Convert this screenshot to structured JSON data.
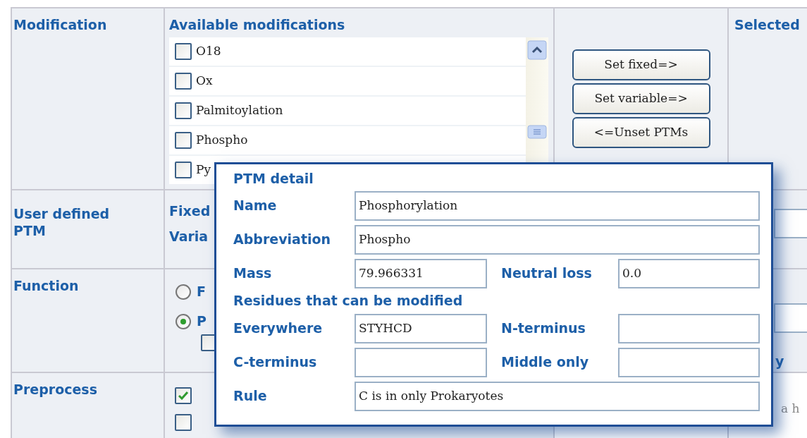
{
  "modification": {
    "label": "Modification",
    "list_title": "Available modifications",
    "items": [
      {
        "label": "O18",
        "checked": false
      },
      {
        "label": "Ox",
        "checked": false
      },
      {
        "label": "Palmitoylation",
        "checked": false
      },
      {
        "label": "Phospho",
        "checked": false
      },
      {
        "label": "Py",
        "checked": false
      }
    ],
    "buttons": [
      "Set fixed=>",
      "Set variable=>",
      "<=Unset PTMs"
    ],
    "selected_title": "Selected"
  },
  "user_defined_ptm": {
    "label": "User defined PTM",
    "lines": [
      "Fixed",
      "Varia"
    ]
  },
  "function": {
    "label": "Function",
    "options": [
      {
        "label": "F",
        "selected": false
      },
      {
        "label": "P",
        "selected": true
      }
    ],
    "sub_checkbox": {
      "checked": false
    }
  },
  "preprocess": {
    "label": "Preprocess",
    "checkboxes": [
      {
        "checked": true
      },
      {
        "checked": false
      }
    ]
  },
  "right_texts": [
    "y",
    "a h"
  ],
  "ptm_detail": {
    "title": "PTM detail",
    "name": {
      "label": "Name",
      "value": "Phosphorylation"
    },
    "abbreviation": {
      "label": "Abbreviation",
      "value": "Phospho"
    },
    "mass": {
      "label": "Mass",
      "value": "79.966331"
    },
    "neutral_loss": {
      "label": "Neutral loss",
      "value": "0.0"
    },
    "residues_title": "Residues that can be modified",
    "everywhere": {
      "label": "Everywhere",
      "value": "STYHCD"
    },
    "n_terminus": {
      "label": "N-terminus"
    },
    "c_terminus": {
      "label": "C-terminus"
    },
    "middle_only": {
      "label": "Middle only"
    },
    "rule": {
      "label": "Rule",
      "value": "C is in only Prokaryotes"
    }
  }
}
